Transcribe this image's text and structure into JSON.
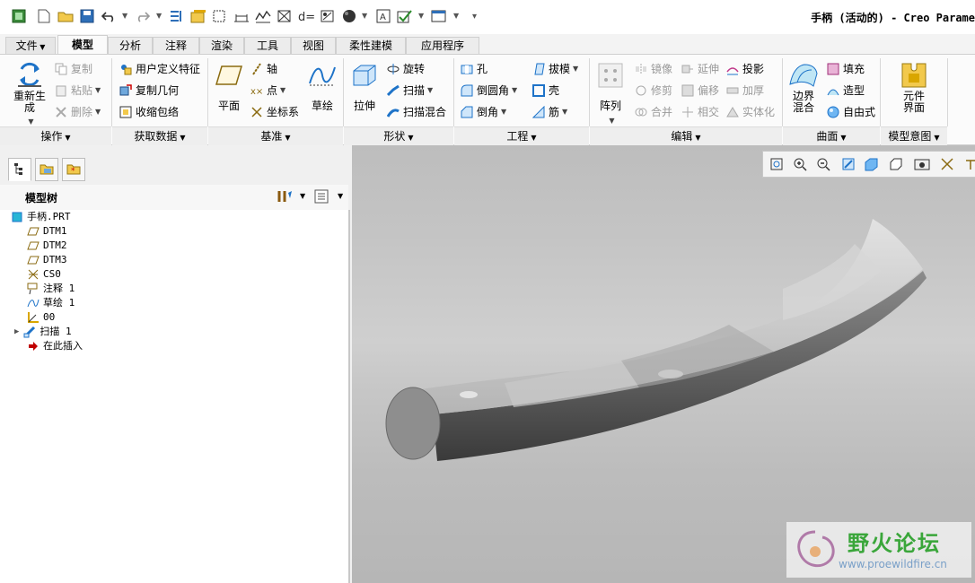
{
  "window": {
    "title": "手柄 (活动的) - Creo Parame"
  },
  "quick_access": {
    "icons": [
      "app-icon",
      "new-icon",
      "open-icon",
      "save-icon",
      "undo-icon",
      "redo-icon",
      "regenerate-icon",
      "windows-icon",
      "close-window-icon",
      "measure-icon",
      "analysis-icon",
      "dimension-icon",
      "named-view-icon",
      "appearance-icon",
      "annotation-display-icon",
      "check-icon",
      "layout-icon",
      "customize-icon"
    ]
  },
  "tabs": [
    {
      "label": "文件"
    },
    {
      "label": "模型"
    },
    {
      "label": "分析"
    },
    {
      "label": "注释"
    },
    {
      "label": "渲染"
    },
    {
      "label": "工具"
    },
    {
      "label": "视图"
    },
    {
      "label": "柔性建模"
    },
    {
      "label": "应用程序"
    }
  ],
  "ribbon": {
    "operations": {
      "group": "操作",
      "regenerate": "重新生成",
      "copy": "复制",
      "paste": "粘贴",
      "delete": "删除"
    },
    "get_data": {
      "group": "获取数据",
      "udf": "用户定义特征",
      "copy_geometry": "复制几何",
      "shrinkwrap": "收缩包络"
    },
    "datum": {
      "group": "基准",
      "plane": "平面",
      "axis": "轴",
      "point": "点",
      "csys": "坐标系",
      "sketch": "草绘"
    },
    "shapes": {
      "group": "形状",
      "extrude": "拉伸",
      "revolve": "旋转",
      "sweep": "扫描",
      "swept_blend": "扫描混合"
    },
    "engineering": {
      "group": "工程",
      "hole": "孔",
      "round": "倒圆角",
      "chamfer": "倒角",
      "draft": "拔模",
      "shell": "壳",
      "rib": "筋"
    },
    "editing": {
      "group": "编辑",
      "pattern": "阵列",
      "mirror": "镜像",
      "trim": "修剪",
      "merge": "合并",
      "extend": "延伸",
      "offset": "偏移",
      "intersect": "相交",
      "project": "投影",
      "thicken": "加厚",
      "solidify": "实体化"
    },
    "surfaces": {
      "group": "曲面",
      "boundary_blend": "边界混合",
      "fill": "填充",
      "style": "造型",
      "freestyle": "自由式"
    },
    "model_intent": {
      "group": "模型意图",
      "component_interface": "元件界面"
    }
  },
  "model_tree": {
    "header": "模型树",
    "items": [
      {
        "label": "手柄.PRT",
        "icon": "part-icon"
      },
      {
        "label": "DTM1",
        "icon": "datum-plane-icon"
      },
      {
        "label": "DTM2",
        "icon": "datum-plane-icon"
      },
      {
        "label": "DTM3",
        "icon": "datum-plane-icon"
      },
      {
        "label": "CS0",
        "icon": "csys-icon"
      },
      {
        "label": "注释 1",
        "icon": "annotation-icon"
      },
      {
        "label": "草绘 1",
        "icon": "sketch-icon"
      },
      {
        "label": "00",
        "icon": "datum-curve-icon"
      },
      {
        "label": "扫描 1",
        "icon": "sweep-icon"
      },
      {
        "label": "在此插入",
        "icon": "insert-here-icon"
      }
    ]
  },
  "colors": {
    "accent_blue": "#1e73c8",
    "insert_red": "#c00000",
    "viewport_bg": "#c4c4c4",
    "watermark_green": "#3aa63a"
  },
  "watermark": {
    "title": "野火论坛",
    "url": "www.proewildfire.cn"
  }
}
